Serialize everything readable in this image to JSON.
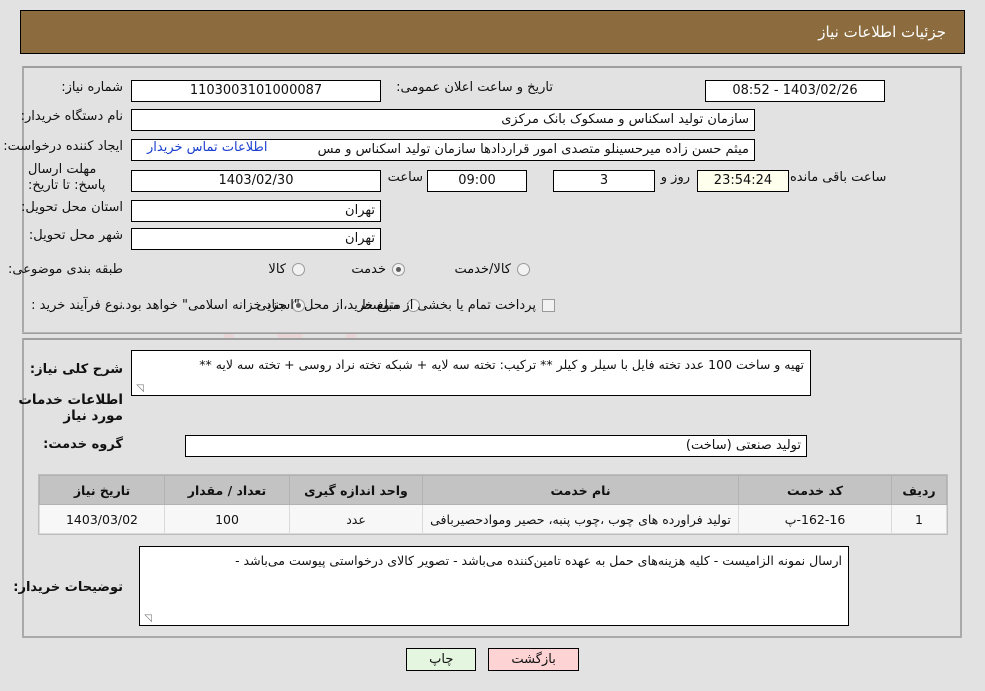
{
  "header": {
    "title": "جزئیات اطلاعات نیاز"
  },
  "form": {
    "need_number_label": "شماره نیاز:",
    "need_number_value": "1103003101000087",
    "announce_date_label": "تاریخ و ساعت اعلان عمومی:",
    "announce_date_value": "1403/02/26 - 08:52",
    "buyer_org_label": "نام دستگاه خریدار:",
    "buyer_org_value": "سازمان تولید اسکناس و مسکوک بانک مرکزی",
    "creator_label": "ایجاد کننده درخواست:",
    "creator_value": "میثم حسن زاده میرحسینلو متصدی امور قراردادها سازمان تولید اسکناس و مس",
    "contact_link": "اطلاعات تماس خریدار",
    "deadline_label": "مهلت ارسال پاسخ: تا تاریخ:",
    "deadline_date": "1403/02/30",
    "deadline_hour_label": "ساعت",
    "deadline_hour_value": "09:00",
    "remaining_days": "3",
    "remaining_days_label": "روز و",
    "remaining_time": "23:54:24",
    "remaining_time_label": "ساعت باقی مانده",
    "province_label": "استان محل تحویل:",
    "province_value": "تهران",
    "city_label": "شهر محل تحویل:",
    "city_value": "تهران",
    "classification_label": "طبقه بندی موضوعی:",
    "classification_options": [
      {
        "label": "کالا",
        "selected": false
      },
      {
        "label": "خدمت",
        "selected": true
      },
      {
        "label": "کالا/خدمت",
        "selected": false
      }
    ],
    "process_type_label": "نوع فرآیند خرید :",
    "process_type_options": [
      {
        "label": "جزیی",
        "selected": true
      },
      {
        "label": "متوسط",
        "selected": false
      }
    ],
    "treasury_checkbox_label": "پرداخت تمام یا بخشی از مبلغ خرید،از محل \"اسناد خزانه اسلامی\" خواهد بود.",
    "treasury_checkbox_checked": false
  },
  "description": {
    "label": "شرح کلی نیاز:",
    "value": "تهیه و ساخت 100 عدد تخته فایل با سیلر و کیلر ** ترکیب: تخته سه لایه + شبکه تخته نراد روسی + تخته سه لایه **"
  },
  "services": {
    "section_title": "اطلاعات خدمات مورد نیاز",
    "group_label": "گروه خدمت:",
    "group_value": "تولید صنعتی (ساخت)",
    "columns": [
      "ردیف",
      "کد خدمت",
      "نام خدمت",
      "واحد اندازه گیری",
      "تعداد / مقدار",
      "تاریخ نیاز"
    ],
    "rows": [
      {
        "index": "1",
        "code": "162-16-پ",
        "name": "تولید فراورده های چوب ،چوب پنبه، حصیر وموادحصیربافی",
        "unit": "عدد",
        "quantity": "100",
        "need_date": "1403/03/02"
      }
    ]
  },
  "buyer_notes": {
    "label": "توضیحات خریدار:",
    "value": "ارسال نمونه الزامیست - کلیه هزینه‌های حمل به عهده تامین‌کننده می‌باشد - تصویر کالای درخواستی پیوست می‌باشد -"
  },
  "footer": {
    "print_label": "چاپ",
    "back_label": "بازگشت"
  },
  "colors": {
    "header_bar": "#8c6c3e",
    "page_background": "#e2e2e2",
    "link": "#1a3fd0",
    "table_header": "#c3c3c3",
    "back_button": "#fdd3d3",
    "print_button": "#e4f6e0",
    "countdown_field": "#ffffee"
  }
}
